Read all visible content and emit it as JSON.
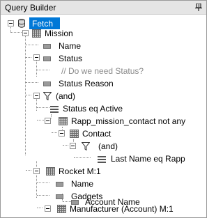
{
  "window": {
    "title": "Query Builder"
  },
  "tree": {
    "fetch": "Fetch",
    "mission": "Mission",
    "name": "Name",
    "status": "Status",
    "status_comment": "//  Do we need Status?",
    "status_reason": "Status Reason",
    "and_filter": "(and)",
    "status_condition": "Status eq Active",
    "rapp_link": "Rapp_mission_contact not any",
    "contact": "Contact",
    "contact_and_filter": "(and)",
    "contact_condition": "Last Name eq Rapp",
    "rocket_link": "Rocket M:1",
    "rocket_name": "Name",
    "rocket_gadgets": "Gadgets",
    "manufacturer_link": "Manufacturer (Account) M:1",
    "account_name": "Account Name"
  },
  "colors": {
    "selection": "#0078d7",
    "comment": "#8a8a8a"
  }
}
